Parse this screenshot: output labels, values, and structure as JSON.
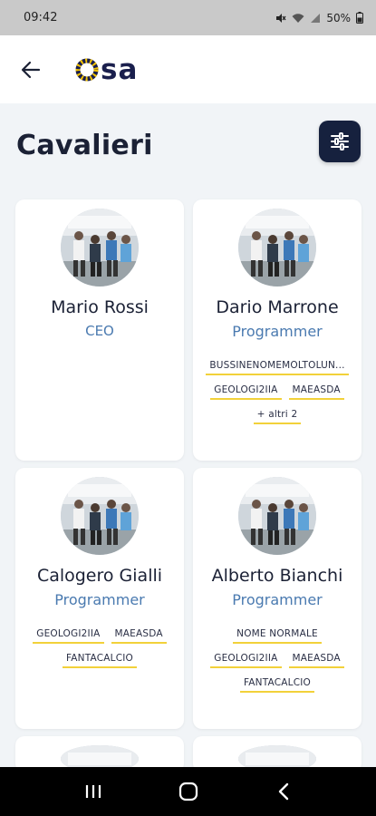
{
  "status": {
    "time": "09:42",
    "battery": "50%"
  },
  "header": {
    "logo_text": "osa"
  },
  "page": {
    "title": "Cavalieri"
  },
  "colors": {
    "accent": "#16213e",
    "role": "#4a7ab0",
    "tag_underline": "#f2d13a"
  },
  "cards": [
    {
      "name": "Mario Rossi",
      "role": "CEO",
      "tags": []
    },
    {
      "name": "Dario Marrone",
      "role": "Programmer",
      "tags": [
        "BUSSINENOMEMOLTOLUN...",
        "GEOLOGI2IIA",
        "MAEASDA",
        "+ altri 2"
      ]
    },
    {
      "name": "Calogero Gialli",
      "role": "Programmer",
      "tags": [
        "GEOLOGI2IIA",
        "MAEASDA",
        "FANTACALCIO"
      ]
    },
    {
      "name": "Alberto Bianchi",
      "role": "Programmer",
      "tags": [
        "NOME NORMALE",
        "GEOLOGI2IIA",
        "MAEASDA",
        "FANTACALCIO"
      ]
    },
    {
      "name": "",
      "role": "",
      "tags": []
    },
    {
      "name": "",
      "role": "",
      "tags": []
    }
  ],
  "icons": {
    "back": "arrow-left-icon",
    "filter": "sliders-icon",
    "nav": [
      "recent-apps-icon",
      "home-icon",
      "back-nav-icon"
    ]
  }
}
